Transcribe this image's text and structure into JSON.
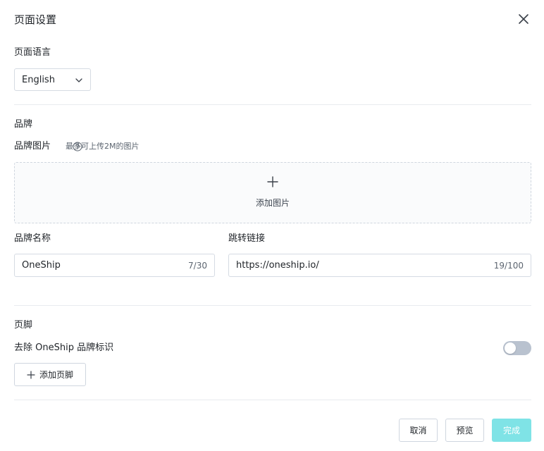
{
  "dialog": {
    "title": "页面设置",
    "close_icon": "close-icon"
  },
  "language": {
    "label": "页面语言",
    "selected": "English"
  },
  "brand": {
    "section_title": "品牌",
    "image_label": "品牌图片",
    "image_hint": "最多可上传2M的图片",
    "upload_text": "添加图片",
    "name_label": "品牌名称",
    "name_value": "OneShip",
    "name_count": "7/30",
    "link_label": "跳转链接",
    "link_value": "https://oneship.io/",
    "link_count": "19/100"
  },
  "footer": {
    "section_title": "页脚",
    "remove_brand_label": "去除 OneShip 品牌标识",
    "remove_brand_enabled": false,
    "add_footer_label": "添加页脚"
  },
  "actions": {
    "cancel": "取消",
    "preview": "预览",
    "done": "完成"
  },
  "colors": {
    "primary_disabled": "#7fe3e6",
    "toggle_off": "#b9c2cf",
    "border": "#d5dbe3"
  }
}
